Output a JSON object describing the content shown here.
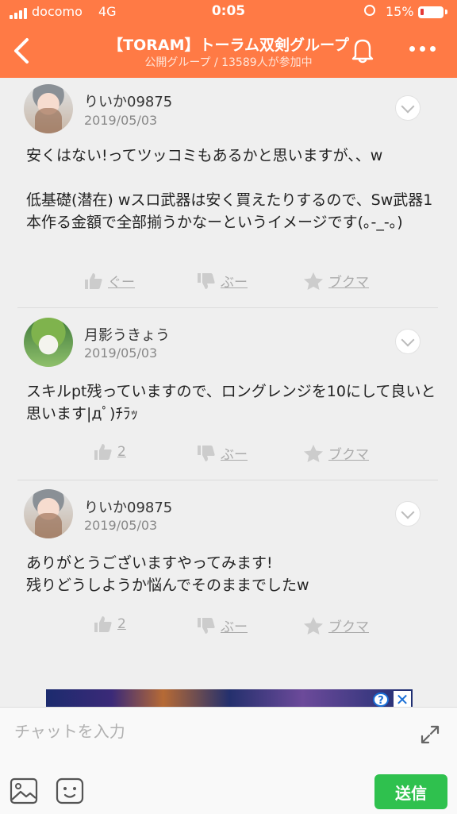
{
  "status_bar": {
    "carrier": "docomo",
    "network": "4G",
    "time": "0:05",
    "battery": "15%"
  },
  "header": {
    "title": "【TORAM】トーラム双剣グループ",
    "subtitle": "公開グループ / 13589人が参加中"
  },
  "posts": [
    {
      "username": "りいか09875",
      "date": "2019/05/03",
      "body": "安くはない!ってツッコミもあるかと思いますが、、w\n\n低基礎(潜在) wスロ武器は安く買えたりするので、Sw武器1本作る金額で全部揃うかなーというイメージです(｡-_-｡)",
      "like": "ぐー",
      "dislike": "ぶー",
      "bookmark": "ブクマ"
    },
    {
      "username": "月影うきょう",
      "date": "2019/05/03",
      "body": "スキルpt残っていますので、ロングレンジを10にして良いと思います|дﾟ)ﾁﾗｯ",
      "like": "2",
      "dislike": "ぶー",
      "bookmark": "ブクマ"
    },
    {
      "username": "りいか09875",
      "date": "2019/05/03",
      "body": "ありがとうございますやってみます!\n残りどうしようか悩んでそのままでしたw",
      "like": "2",
      "dislike": "ぶー",
      "bookmark": "ブクマ"
    }
  ],
  "input": {
    "placeholder": "チャットを入力",
    "send_label": "送信"
  },
  "colors": {
    "header": "#ff7a45",
    "send": "#2fc14e",
    "background": "#efefef"
  }
}
